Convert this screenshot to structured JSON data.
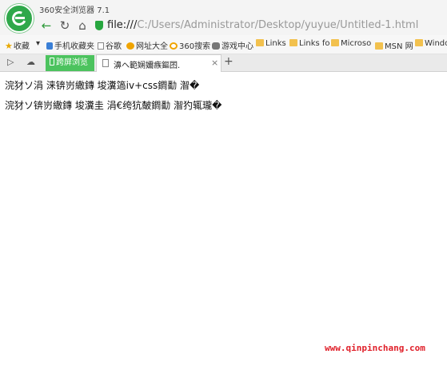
{
  "window": {
    "title": "360安全浏览器 7.1",
    "brand_color": "#2fa84a"
  },
  "navbar": {
    "back_icon": "arrow-left-icon",
    "refresh_icon": "refresh-icon",
    "home_icon": "home-icon",
    "address_prefix": "file:///",
    "address_path": "C:/Users/Administrator/Desktop/yuyue/Untitled-1.html"
  },
  "bookmarks": {
    "items": [
      {
        "label": "收藏",
        "icon": "star-icon"
      },
      {
        "label": "▾",
        "icon": ""
      },
      {
        "label": "手机收藏夹",
        "icon": "phone-icon"
      },
      {
        "label": "谷歌",
        "icon": "page-icon"
      },
      {
        "label": "网址大全",
        "icon": "grid-icon"
      },
      {
        "label": "360搜索",
        "icon": "360-icon"
      },
      {
        "label": "游戏中心",
        "icon": "gamepad-icon"
      },
      {
        "label": "Links",
        "icon": "folder-icon"
      },
      {
        "label": "Links fo",
        "icon": "folder-icon"
      },
      {
        "label": "Microso",
        "icon": "folder-icon"
      },
      {
        "label": "MSN 网",
        "icon": "folder-icon"
      },
      {
        "label": "Windo",
        "icon": "folder-icon"
      }
    ]
  },
  "tabs": {
    "special_label": "跨屏浏览",
    "active_title": "濞ヘ範娴嬭瘯鏂囨.",
    "close_label": "×",
    "new_tab_label": "+"
  },
  "content": {
    "lines": [
      "浣犲ソ涓  涞锛岃繖鏄  埈瀵簻iv+css鐧勫  潪�",
      "浣犲ソ锛岃繖鏄  埈瀵圭  涓€绔犺皶鐧勫  潪犳辄瓏�"
    ]
  },
  "watermark": {
    "text": "www.qinpinchang.com",
    "color": "#e0202a"
  }
}
